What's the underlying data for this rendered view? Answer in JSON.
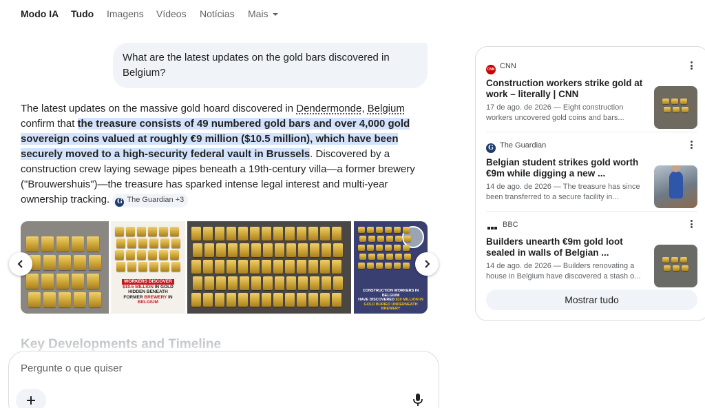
{
  "nav": {
    "tabs": [
      {
        "label": "Modo IA"
      },
      {
        "label": "Tudo"
      },
      {
        "label": "Imagens"
      },
      {
        "label": "Vídeos"
      },
      {
        "label": "Notícias"
      },
      {
        "label": "Mais"
      }
    ]
  },
  "query": {
    "text": "What are the latest updates on the gold bars discovered in Belgium?"
  },
  "answer": {
    "part1": "The latest updates on the massive gold hoard discovered in ",
    "place1": "Dendermonde",
    "comma": ", ",
    "place2": "Belgium",
    "part2": " confirm that ",
    "highlight": "the treasure consists of 49 numbered gold bars and over 4,000 gold sovereign coins valued at roughly €9 million ($10.5 million), which have been securely moved to a high-security federal vault in Brussels",
    "part3": ". Discovered by a construction crew laying sewage pipes beneath a 19th-century villa—a former brewery (\"Brouwershuis\")—the treasure has sparked intense legal interest and multi-year ownership tracking.",
    "source_chip": "The Guardian +3",
    "source_chip_logo": "G"
  },
  "images": {
    "img2_caption": {
      "line1": "WORKERS DISCOVER",
      "line2": "$10.5 MILLION",
      "line2b": "IN GOLD",
      "line3": "HIDDEN BENEATH",
      "line4": "FORMER",
      "line4b": "BREWERY",
      "line4c": "IN",
      "line5": "BELGIUM"
    },
    "img4_caption": {
      "line1": "CONSTRUCTION WORKERS IN BELGIUM",
      "line2": "HAVE DISCOVERED",
      "line2b": "$10 MILLION IN",
      "line3": "GOLD BURIED UNDERNEATH BREWERY"
    }
  },
  "key_heading": "Key Developments and Timeline",
  "prompt": {
    "placeholder": "Pergunte o que quiser"
  },
  "sources": {
    "items": [
      {
        "publisher": "CNN",
        "logo": "CNN",
        "title": "Construction workers strike gold at work – literally | CNN",
        "snippet": "17 de ago. de 2026 — Eight construction workers uncovered gold coins and bars..."
      },
      {
        "publisher": "The Guardian",
        "logo": "G",
        "title": "Belgian student strikes gold worth €9m while digging a new ...",
        "snippet": "14 de ago. de 2026 — The treasure has since been transferred to a secure facility in..."
      },
      {
        "publisher": "BBC",
        "logo": "BBC",
        "title": "Builders unearth €9m gold loot sealed in walls of Belgian ...",
        "snippet": "14 de ago. de 2026 — Builders renovating a house in Belgium have discovered a stash o..."
      }
    ],
    "show_all": "Mostrar tudo"
  },
  "colors": {
    "highlight": "#d3e3fd",
    "accent_red": "#c4161c",
    "gold": "#c9a133"
  },
  "icons": [
    "chevron-left-icon",
    "chevron-right-icon",
    "plus-icon",
    "mic-icon",
    "more-vert-icon",
    "chevron-down-icon"
  ]
}
